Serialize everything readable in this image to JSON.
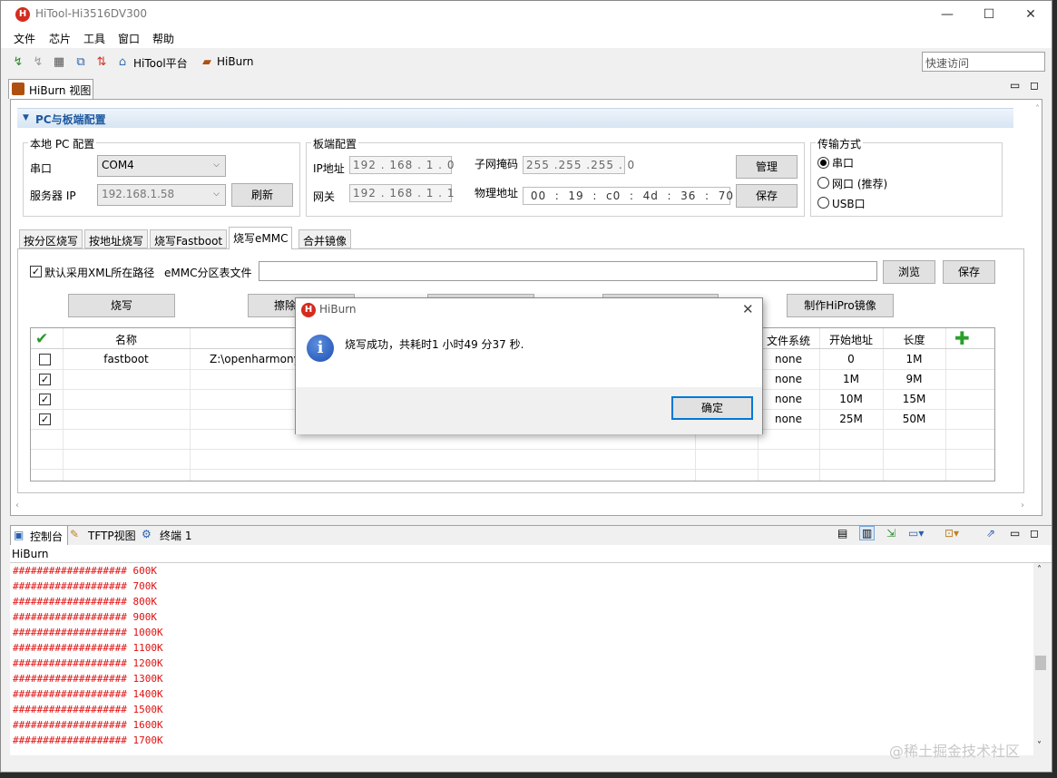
{
  "window": {
    "title": "HiTool-Hi3516DV300",
    "logo_text": "H",
    "minimize": "—",
    "maximize": "☐",
    "close": "✕"
  },
  "menu": [
    "文件",
    "芯片",
    "工具",
    "窗口",
    "帮助"
  ],
  "toolbar": {
    "hitool_platform": "HiTool平台",
    "hiburn": "HiBurn",
    "quick_access": "快速访问"
  },
  "view_tab": {
    "label": "HiBurn 视图"
  },
  "section": {
    "title": "PC与板端配置"
  },
  "local_pc": {
    "title": "本地 PC 配置",
    "serial_label": "串口",
    "serial_value": "COM4",
    "server_ip_label": "服务器 IP",
    "server_ip_value": "192.168.1.58",
    "refresh": "刷新"
  },
  "board": {
    "title": "板端配置",
    "ip_label": "IP地址",
    "ip": [
      "192",
      "168",
      "1",
      "0"
    ],
    "gateway_label": "网关",
    "gateway": [
      "192",
      "168",
      "1",
      "1"
    ],
    "mask_label": "子网掩码",
    "mask": [
      "255",
      "255",
      "255",
      "0"
    ],
    "mac_label": "物理地址",
    "mac": [
      "00",
      "19",
      "c0",
      "4d",
      "36",
      "70"
    ],
    "manage": "管理",
    "save": "保存"
  },
  "transfer": {
    "title": "传输方式",
    "options": [
      "串口",
      "网口 (推荐)",
      "USB口"
    ],
    "selected": 0
  },
  "burn_tabs": [
    "按分区烧写",
    "按地址烧写",
    "烧写Fastboot",
    "烧写eMMC",
    "合并镜像"
  ],
  "emmc": {
    "xml_checkbox": "默认采用XML所在路径",
    "table_label": "eMMC分区表文件",
    "table_value": "",
    "browse": "浏览",
    "save": "保存"
  },
  "actions": {
    "burn": "烧写",
    "erase": "擦除",
    "hipro": "制作HiPro镜像"
  },
  "table": {
    "headers": {
      "name": "名称",
      "fs": "文件系统",
      "start": "开始地址",
      "length": "长度"
    },
    "rows": [
      {
        "checked": false,
        "name": "fastboot",
        "path": "Z:\\openharmony",
        "fs": "none",
        "start": "0",
        "length": "1M"
      },
      {
        "checked": true,
        "name": "",
        "path": "",
        "fs": "none",
        "start": "1M",
        "length": "9M"
      },
      {
        "checked": true,
        "name": "",
        "path": "",
        "fs": "none",
        "start": "10M",
        "length": "15M"
      },
      {
        "checked": true,
        "name": "",
        "path": "",
        "fs": "none",
        "start": "25M",
        "length": "50M"
      }
    ]
  },
  "bottom_tabs": [
    "控制台",
    "TFTP视图",
    "终端 1"
  ],
  "console": {
    "title": "HiBurn",
    "lines": [
      "################### 600K",
      "################### 700K",
      "################### 800K",
      "################### 900K",
      "################### 1000K",
      "################### 1100K",
      "################### 1200K",
      "################### 1300K",
      "################### 1400K",
      "################### 1500K",
      "################### 1600K",
      "################### 1700K"
    ]
  },
  "dialog": {
    "title": "HiBurn",
    "message": "烧写成功，共耗时1 小时49 分37 秒.",
    "ok": "确定",
    "icon": "i"
  },
  "watermark": "@稀土掘金技术社区",
  "colors": {
    "console_text": "#e01010",
    "accent": "#0078d7",
    "section_title": "#1f5aa0"
  }
}
